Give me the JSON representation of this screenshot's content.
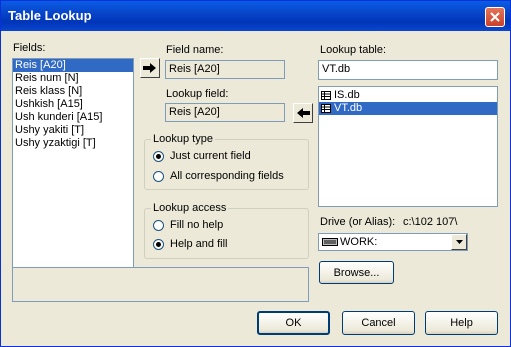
{
  "window": {
    "title": "Table Lookup"
  },
  "fields": {
    "label": "Fields:",
    "items": [
      "Reis [A20]",
      "Reis num [N]",
      "Reis klass [N]",
      "Ushkish [A15]",
      "Ush kunderi [A15]",
      "Ushy yakiti [T]",
      "Ushy  yzaktigi [T]"
    ],
    "selected_index": 0
  },
  "field_name": {
    "label": "Field name:",
    "value": "Reis [A20]"
  },
  "lookup_field": {
    "label": "Lookup field:",
    "value": "Reis [A20]"
  },
  "lookup_type": {
    "label": "Lookup type",
    "options": [
      "Just current field",
      "All corresponding fields"
    ],
    "selected_index": 0
  },
  "lookup_access": {
    "label": "Lookup access",
    "options": [
      "Fill no help",
      "Help and fill"
    ],
    "selected_index": 1
  },
  "lookup_table": {
    "label": "Lookup table:",
    "value": "VT.db",
    "items": [
      "IS.db",
      "VT.db"
    ],
    "selected_index": 1
  },
  "drive": {
    "label": "Drive (or Alias):",
    "path": "c:\\102 107\\",
    "selected": "WORK:"
  },
  "buttons": {
    "browse": "Browse...",
    "ok": "OK",
    "cancel": "Cancel",
    "help": "Help"
  },
  "colors": {
    "title_bar": "#0845c8",
    "selection": "#316ac5",
    "dialog_bg": "#ece9d8"
  }
}
